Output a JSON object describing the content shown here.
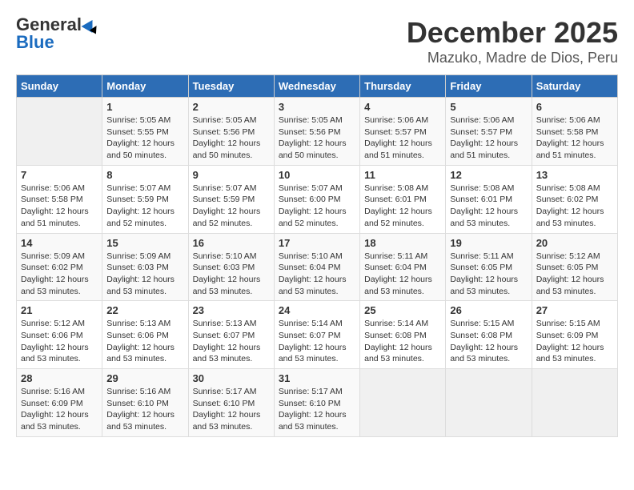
{
  "header": {
    "logo_general": "General",
    "logo_blue": "Blue",
    "month_title": "December 2025",
    "location": "Mazuko, Madre de Dios, Peru"
  },
  "weekdays": [
    "Sunday",
    "Monday",
    "Tuesday",
    "Wednesday",
    "Thursday",
    "Friday",
    "Saturday"
  ],
  "days": [
    {
      "date": null,
      "sunrise": null,
      "sunset": null,
      "daylight": null
    },
    {
      "date": "1",
      "sunrise": "5:05 AM",
      "sunset": "5:55 PM",
      "daylight": "12 hours and 50 minutes."
    },
    {
      "date": "2",
      "sunrise": "5:05 AM",
      "sunset": "5:56 PM",
      "daylight": "12 hours and 50 minutes."
    },
    {
      "date": "3",
      "sunrise": "5:05 AM",
      "sunset": "5:56 PM",
      "daylight": "12 hours and 50 minutes."
    },
    {
      "date": "4",
      "sunrise": "5:06 AM",
      "sunset": "5:57 PM",
      "daylight": "12 hours and 51 minutes."
    },
    {
      "date": "5",
      "sunrise": "5:06 AM",
      "sunset": "5:57 PM",
      "daylight": "12 hours and 51 minutes."
    },
    {
      "date": "6",
      "sunrise": "5:06 AM",
      "sunset": "5:58 PM",
      "daylight": "12 hours and 51 minutes."
    },
    {
      "date": "7",
      "sunrise": "5:06 AM",
      "sunset": "5:58 PM",
      "daylight": "12 hours and 51 minutes."
    },
    {
      "date": "8",
      "sunrise": "5:07 AM",
      "sunset": "5:59 PM",
      "daylight": "12 hours and 52 minutes."
    },
    {
      "date": "9",
      "sunrise": "5:07 AM",
      "sunset": "5:59 PM",
      "daylight": "12 hours and 52 minutes."
    },
    {
      "date": "10",
      "sunrise": "5:07 AM",
      "sunset": "6:00 PM",
      "daylight": "12 hours and 52 minutes."
    },
    {
      "date": "11",
      "sunrise": "5:08 AM",
      "sunset": "6:01 PM",
      "daylight": "12 hours and 52 minutes."
    },
    {
      "date": "12",
      "sunrise": "5:08 AM",
      "sunset": "6:01 PM",
      "daylight": "12 hours and 53 minutes."
    },
    {
      "date": "13",
      "sunrise": "5:08 AM",
      "sunset": "6:02 PM",
      "daylight": "12 hours and 53 minutes."
    },
    {
      "date": "14",
      "sunrise": "5:09 AM",
      "sunset": "6:02 PM",
      "daylight": "12 hours and 53 minutes."
    },
    {
      "date": "15",
      "sunrise": "5:09 AM",
      "sunset": "6:03 PM",
      "daylight": "12 hours and 53 minutes."
    },
    {
      "date": "16",
      "sunrise": "5:10 AM",
      "sunset": "6:03 PM",
      "daylight": "12 hours and 53 minutes."
    },
    {
      "date": "17",
      "sunrise": "5:10 AM",
      "sunset": "6:04 PM",
      "daylight": "12 hours and 53 minutes."
    },
    {
      "date": "18",
      "sunrise": "5:11 AM",
      "sunset": "6:04 PM",
      "daylight": "12 hours and 53 minutes."
    },
    {
      "date": "19",
      "sunrise": "5:11 AM",
      "sunset": "6:05 PM",
      "daylight": "12 hours and 53 minutes."
    },
    {
      "date": "20",
      "sunrise": "5:12 AM",
      "sunset": "6:05 PM",
      "daylight": "12 hours and 53 minutes."
    },
    {
      "date": "21",
      "sunrise": "5:12 AM",
      "sunset": "6:06 PM",
      "daylight": "12 hours and 53 minutes."
    },
    {
      "date": "22",
      "sunrise": "5:13 AM",
      "sunset": "6:06 PM",
      "daylight": "12 hours and 53 minutes."
    },
    {
      "date": "23",
      "sunrise": "5:13 AM",
      "sunset": "6:07 PM",
      "daylight": "12 hours and 53 minutes."
    },
    {
      "date": "24",
      "sunrise": "5:14 AM",
      "sunset": "6:07 PM",
      "daylight": "12 hours and 53 minutes."
    },
    {
      "date": "25",
      "sunrise": "5:14 AM",
      "sunset": "6:08 PM",
      "daylight": "12 hours and 53 minutes."
    },
    {
      "date": "26",
      "sunrise": "5:15 AM",
      "sunset": "6:08 PM",
      "daylight": "12 hours and 53 minutes."
    },
    {
      "date": "27",
      "sunrise": "5:15 AM",
      "sunset": "6:09 PM",
      "daylight": "12 hours and 53 minutes."
    },
    {
      "date": "28",
      "sunrise": "5:16 AM",
      "sunset": "6:09 PM",
      "daylight": "12 hours and 53 minutes."
    },
    {
      "date": "29",
      "sunrise": "5:16 AM",
      "sunset": "6:10 PM",
      "daylight": "12 hours and 53 minutes."
    },
    {
      "date": "30",
      "sunrise": "5:17 AM",
      "sunset": "6:10 PM",
      "daylight": "12 hours and 53 minutes."
    },
    {
      "date": "31",
      "sunrise": "5:17 AM",
      "sunset": "6:10 PM",
      "daylight": "12 hours and 53 minutes."
    }
  ],
  "labels": {
    "sunrise_prefix": "Sunrise: ",
    "sunset_prefix": "Sunset: ",
    "daylight_prefix": "Daylight: "
  }
}
